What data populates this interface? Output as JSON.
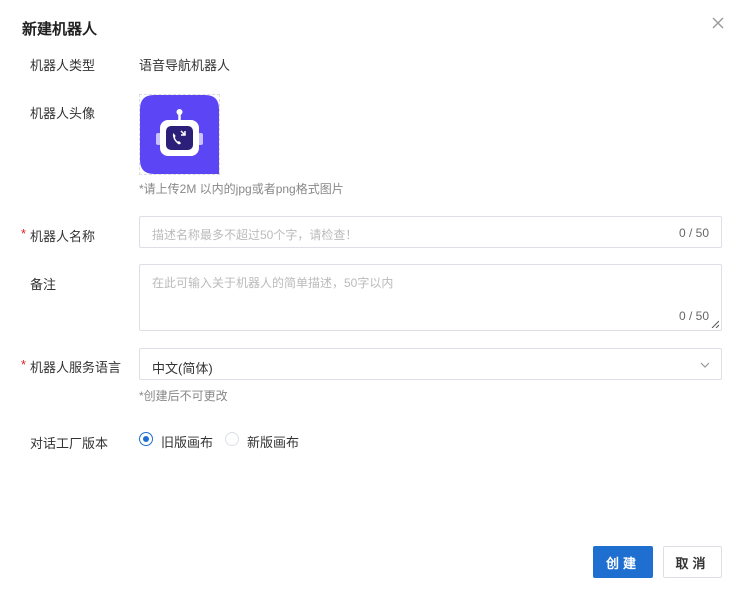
{
  "dialog": {
    "title": "新建机器人",
    "close_icon": "close-icon"
  },
  "form": {
    "type": {
      "label": "机器人类型",
      "value": "语音导航机器人"
    },
    "avatar": {
      "label": "机器人头像",
      "hint": "*请上传2M 以内的jpg或者png格式图片",
      "icon": "robot-phone-icon",
      "bg_color": "#5b45f5"
    },
    "name": {
      "required_mark": "*",
      "label": "机器人名称",
      "placeholder": "描述名称最多不超过50个字，请检查！",
      "count": "0 / 50"
    },
    "remark": {
      "label": "备注",
      "placeholder": "在此可输入关于机器人的简单描述，50字以内",
      "count": "0 / 50"
    },
    "language": {
      "required_mark": "*",
      "label": "机器人服务语言",
      "selected": "中文(简体)",
      "hint": "*创建后不可更改"
    },
    "version": {
      "label": "对话工厂版本",
      "options": [
        {
          "label": "旧版画布",
          "checked": true
        },
        {
          "label": "新版画布",
          "checked": false
        }
      ]
    }
  },
  "footer": {
    "create_label": "创建",
    "cancel_label": "取消"
  },
  "colors": {
    "primary": "#1f6fd1",
    "required": "#e02020"
  }
}
